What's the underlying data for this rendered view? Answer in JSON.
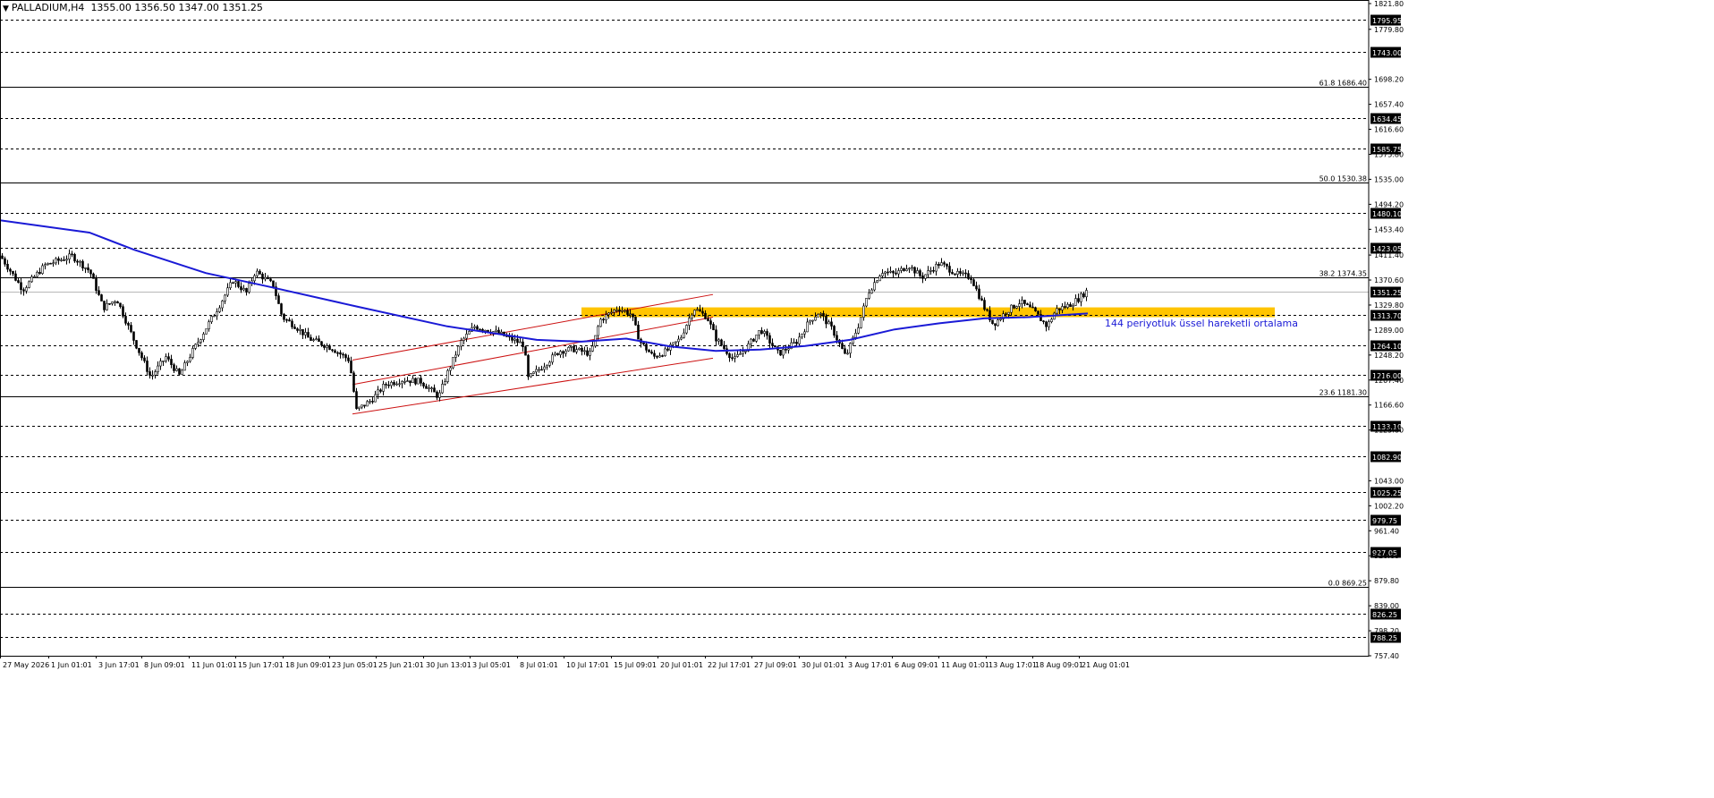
{
  "header": {
    "symbol": "PALLADIUM,H4",
    "ohlc": "1355.00 1356.50 1347.00 1351.25"
  },
  "chart_data": {
    "type": "candlestick",
    "y_range": [
      757.4,
      1821.8
    ],
    "y_ticks": [
      "1821.80",
      "1779.80",
      "1698.20",
      "1657.40",
      "1616.60",
      "1575.80",
      "1535.00",
      "1494.20",
      "1453.40",
      "1411.40",
      "1370.60",
      "1329.80",
      "1289.00",
      "1248.20",
      "1207.40",
      "1166.60",
      "1125.80",
      "1043.00",
      "1002.20",
      "961.40",
      "920.60",
      "879.80",
      "839.00",
      "798.20",
      "757.40"
    ],
    "x_labels": [
      "27 May 2026",
      "1 Jun 01:01",
      "3 Jun 17:01",
      "8 Jun 09:01",
      "11 Jun 01:01",
      "15 Jun 17:01",
      "18 Jun 09:01",
      "23 Jun 05:01",
      "25 Jun 21:01",
      "30 Jun 13:01",
      "3 Jul 05:01",
      "8 Jul 01:01",
      "10 Jul 17:01",
      "15 Jul 09:01",
      "20 Jul 01:01",
      "22 Jul 17:01",
      "27 Jul 09:01",
      "30 Jul 01:01",
      "3 Aug 17:01",
      "6 Aug 09:01",
      "11 Aug 01:01",
      "13 Aug 17:01",
      "18 Aug 09:01",
      "21 Aug 01:01"
    ],
    "horizontal_levels": [
      "1795.95",
      "1743.00",
      "1634.45",
      "1585.75",
      "1480.10",
      "1423.05",
      "1313.70",
      "1264.10",
      "1216.00",
      "1133.10",
      "1082.90",
      "1025.25",
      "979.75",
      "927.05",
      "826.25",
      "788.25"
    ],
    "current_price": "1351.25",
    "fibonacci": [
      {
        "label": "61.8 1686.40",
        "value": 1686.4
      },
      {
        "label": "50.0 1530.38",
        "value": 1530.38
      },
      {
        "label": "38.2 1374.35",
        "value": 1374.35
      },
      {
        "label": "23.6 1181.30",
        "value": 1181.3
      },
      {
        "label": "0.0 869.25",
        "value": 869.25
      }
    ],
    "zone": {
      "low": 1310,
      "high": 1326,
      "color": "#ffc400"
    },
    "ema": {
      "label": "144 periyotluk üssel hareketli ortalama",
      "color": "#1a1ad6",
      "points": [
        [
          0,
          1468
        ],
        [
          100,
          1448
        ],
        [
          150,
          1420
        ],
        [
          230,
          1382
        ],
        [
          300,
          1360
        ],
        [
          400,
          1327
        ],
        [
          500,
          1295
        ],
        [
          550,
          1284
        ],
        [
          600,
          1273
        ],
        [
          650,
          1270
        ],
        [
          700,
          1275
        ],
        [
          750,
          1262
        ],
        [
          800,
          1255
        ],
        [
          850,
          1257
        ],
        [
          900,
          1263
        ],
        [
          950,
          1273
        ],
        [
          1000,
          1290
        ],
        [
          1050,
          1300
        ],
        [
          1100,
          1308
        ],
        [
          1150,
          1310
        ],
        [
          1216,
          1316
        ]
      ]
    },
    "channel": {
      "color": "#cc1111",
      "upper": [
        [
          394,
          1240
        ],
        [
          797,
          1347
        ]
      ],
      "middle": [
        [
          394,
          1200
        ],
        [
          797,
          1310
        ]
      ],
      "lower": [
        [
          394,
          1152
        ],
        [
          797,
          1243
        ]
      ]
    },
    "candles_path": [
      [
        0,
        1410
      ],
      [
        25,
        1355
      ],
      [
        50,
        1395
      ],
      [
        80,
        1410
      ],
      [
        100,
        1385
      ],
      [
        115,
        1325
      ],
      [
        130,
        1340
      ],
      [
        150,
        1270
      ],
      [
        168,
        1212
      ],
      [
        185,
        1245
      ],
      [
        200,
        1215
      ],
      [
        215,
        1255
      ],
      [
        245,
        1330
      ],
      [
        260,
        1370
      ],
      [
        275,
        1350
      ],
      [
        285,
        1385
      ],
      [
        305,
        1362
      ],
      [
        315,
        1310
      ],
      [
        330,
        1295
      ],
      [
        345,
        1275
      ],
      [
        370,
        1260
      ],
      [
        390,
        1240
      ],
      [
        398,
        1158
      ],
      [
        415,
        1175
      ],
      [
        430,
        1200
      ],
      [
        450,
        1208
      ],
      [
        470,
        1205
      ],
      [
        490,
        1180
      ],
      [
        500,
        1220
      ],
      [
        515,
        1270
      ],
      [
        530,
        1295
      ],
      [
        555,
        1285
      ],
      [
        570,
        1275
      ],
      [
        585,
        1265
      ],
      [
        590,
        1210
      ],
      [
        610,
        1235
      ],
      [
        625,
        1255
      ],
      [
        640,
        1258
      ],
      [
        660,
        1250
      ],
      [
        670,
        1305
      ],
      [
        690,
        1325
      ],
      [
        705,
        1315
      ],
      [
        715,
        1270
      ],
      [
        730,
        1245
      ],
      [
        745,
        1255
      ],
      [
        760,
        1275
      ],
      [
        775,
        1325
      ],
      [
        790,
        1310
      ],
      [
        800,
        1275
      ],
      [
        820,
        1240
      ],
      [
        835,
        1262
      ],
      [
        850,
        1290
      ],
      [
        870,
        1250
      ],
      [
        890,
        1270
      ],
      [
        905,
        1305
      ],
      [
        915,
        1318
      ],
      [
        930,
        1290
      ],
      [
        945,
        1245
      ],
      [
        960,
        1300
      ],
      [
        970,
        1350
      ],
      [
        985,
        1385
      ],
      [
        1000,
        1380
      ],
      [
        1015,
        1395
      ],
      [
        1030,
        1375
      ],
      [
        1050,
        1398
      ],
      [
        1070,
        1380
      ],
      [
        1085,
        1375
      ],
      [
        1100,
        1325
      ],
      [
        1110,
        1298
      ],
      [
        1125,
        1320
      ],
      [
        1140,
        1335
      ],
      [
        1155,
        1320
      ],
      [
        1170,
        1295
      ],
      [
        1180,
        1322
      ],
      [
        1195,
        1330
      ],
      [
        1205,
        1340
      ],
      [
        1216,
        1355
      ]
    ],
    "annotation_color": "#1a1ad6"
  }
}
